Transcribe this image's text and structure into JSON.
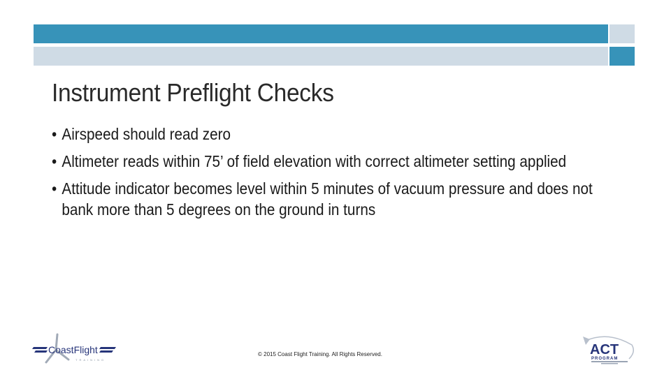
{
  "slide": {
    "title": "Instrument Preflight Checks",
    "bullets": [
      "Airspeed should read zero",
      "Altimeter reads within 75’ of field elevation  with correct altimeter setting applied",
      "Attitude indicator becomes level within 5 minutes of vacuum pressure and does not bank more than 5 degrees on the ground in turns"
    ],
    "bullet_glyph": "•"
  },
  "footer": {
    "copyright": "© 2015 Coast Flight Training. All Rights Reserved.",
    "logo_left": {
      "name": "CoastFlight",
      "sub": "TRAINING"
    },
    "logo_right": {
      "name": "ACT",
      "sub": "PROGRAM"
    }
  },
  "colors": {
    "accent_blue": "#3793b9",
    "light_blue_gray": "#cfdbe5"
  }
}
